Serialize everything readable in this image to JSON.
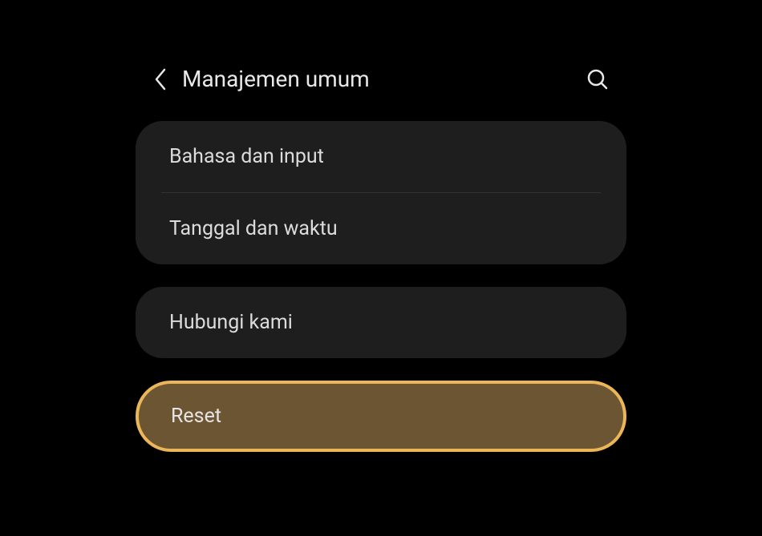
{
  "header": {
    "title": "Manajemen umum"
  },
  "groups": [
    {
      "items": [
        {
          "label": "Bahasa dan input"
        },
        {
          "label": "Tanggal dan waktu"
        }
      ]
    },
    {
      "items": [
        {
          "label": "Hubungi kami"
        }
      ]
    }
  ],
  "highlighted": {
    "label": "Reset"
  }
}
